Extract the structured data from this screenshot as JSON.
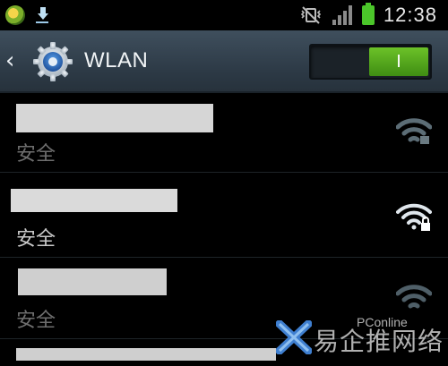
{
  "status_bar": {
    "time": "12:38",
    "icons": [
      "app-notification-icon",
      "download-icon",
      "vibrate-mute-icon",
      "signal-icon",
      "battery-icon"
    ]
  },
  "action_bar": {
    "title": "WLAN",
    "back_icon": "chevron-left-icon",
    "settings_icon": "gear-icon",
    "toggle_label": "I",
    "toggle_state": "on"
  },
  "networks": [
    {
      "ssid": "",
      "security": "安全",
      "signal_icon": "wifi-weak-icon",
      "active": false
    },
    {
      "ssid": "",
      "security": "安全",
      "signal_icon": "wifi-lock-icon",
      "active": true
    },
    {
      "ssid": "",
      "security": "安全",
      "signal_icon": "wifi-weak-icon",
      "active": false
    },
    {
      "ssid": "",
      "security": "",
      "signal_icon": "",
      "active": false
    }
  ],
  "watermark": {
    "text": "易企推网络",
    "sub": "PConline"
  },
  "colors": {
    "accent_green": "#4bc62a",
    "toggle_green": "#57a81d",
    "action_bar": "#34424f",
    "wifi_active": "#dfe6ec",
    "wifi_dim": "#5a6a72"
  }
}
